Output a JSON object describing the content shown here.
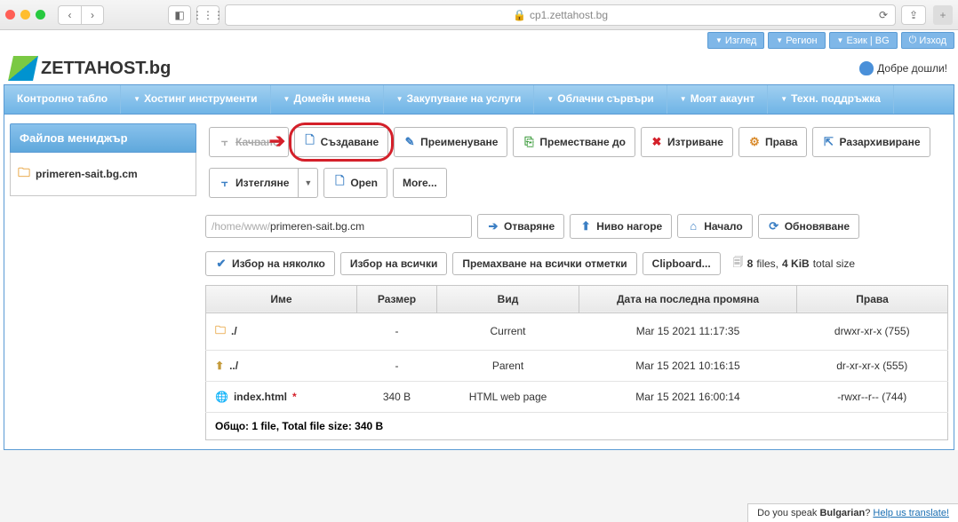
{
  "browser": {
    "url": "cp1.zettahost.bg"
  },
  "util": {
    "view": "Изглед",
    "region": "Регион",
    "lang": "Език | BG",
    "logout": "Изход"
  },
  "logo": "ZETTAHOST.bg",
  "welcome": "Добре дошли!",
  "nav": {
    "dashboard": "Контролно табло",
    "hosting": "Хостинг инструменти",
    "domains": "Домейн имена",
    "buy": "Закупуване на услуги",
    "cloud": "Облачни сървъри",
    "account": "Моят акаунт",
    "support": "Техн. поддръжка"
  },
  "sidebar": {
    "title": "Файлов мениджър",
    "domain": "primeren-sait.bg.cm"
  },
  "toolbar": {
    "upload": "Качване",
    "create": "Създаване",
    "rename": "Преименуване",
    "move": "Преместване до",
    "delete": "Изтриване",
    "perms": "Права",
    "unarchive": "Разархивиране",
    "download": "Изтегляне",
    "open": "Open",
    "more": "More..."
  },
  "path": {
    "prefix": "/home/www/",
    "value": "primeren-sait.bg.cm"
  },
  "pathbtns": {
    "open": "Отваряне",
    "up": "Ниво нагоре",
    "home": "Начало",
    "refresh": "Обновяване"
  },
  "sel": {
    "multi": "Избор на няколко",
    "all": "Избор на всички",
    "clear": "Премахване на всички отметки",
    "clip": "Clipboard..."
  },
  "summary": {
    "filesN": "8",
    "filesW": "files,",
    "sizeN": "4 KiB",
    "sizeW": "total size"
  },
  "cols": {
    "name": "Име",
    "size": "Размер",
    "type": "Вид",
    "date": "Дата на последна промяна",
    "perms": "Права"
  },
  "rows": [
    {
      "name": "./",
      "size": "-",
      "type": "Current",
      "date": "Mar 15 2021 11:17:35",
      "perms": "drwxr-xr-x (755)",
      "icon": "folder"
    },
    {
      "name": "../",
      "size": "-",
      "type": "Parent",
      "date": "Mar 15 2021 10:16:15",
      "perms": "dr-xr-xr-x (555)",
      "icon": "up"
    },
    {
      "name": "index.html",
      "star": "*",
      "size": "340 B",
      "type": "HTML web page",
      "date": "Mar 15 2021 16:00:14",
      "perms": "-rwxr--r-- (744)",
      "icon": "file"
    }
  ],
  "footer": "Общо: 1 file, Total file size: 340 B",
  "translate": {
    "q": "Do you speak ",
    "lang": "Bulgarian",
    "qm": "? ",
    "link": "Help us translate!"
  }
}
